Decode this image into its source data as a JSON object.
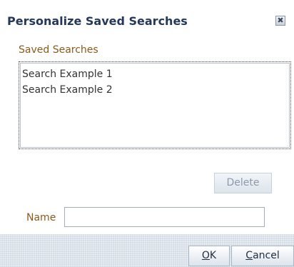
{
  "dialog": {
    "title": "Personalize Saved Searches",
    "close_icon": "close-icon",
    "close_glyph": "✖"
  },
  "saved_searches": {
    "label": "Saved Searches",
    "items": [
      {
        "label": "Search Example 1"
      },
      {
        "label": "Search Example 2"
      }
    ]
  },
  "buttons": {
    "delete": "Delete",
    "ok_mnemonic": "O",
    "ok_rest": "K",
    "cancel_mnemonic": "C",
    "cancel_rest": "ancel"
  },
  "name_field": {
    "label": "Name",
    "value": ""
  },
  "colors": {
    "title": "#24395a",
    "label": "#8b5a1b",
    "footer": "#d5dde7"
  }
}
